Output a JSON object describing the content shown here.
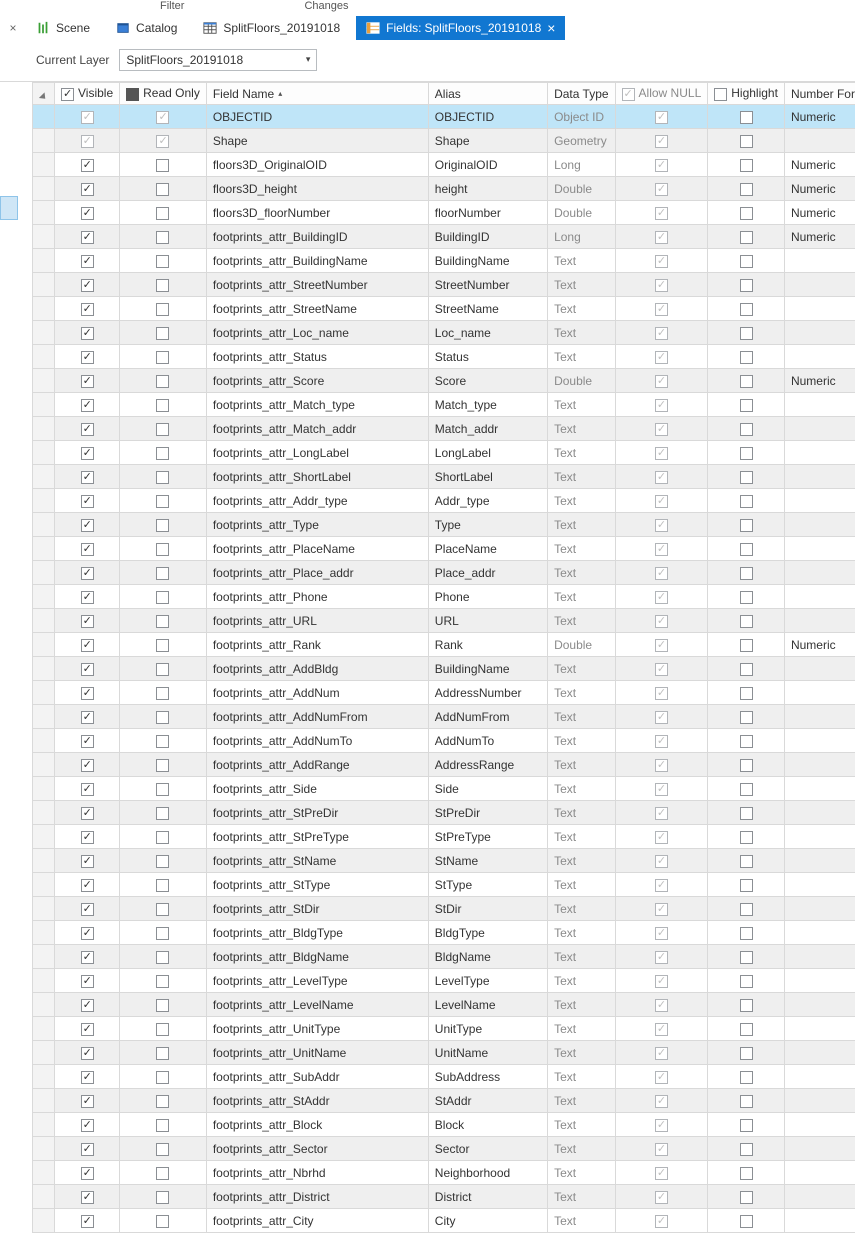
{
  "topmenu": {
    "filter": "Filter",
    "changes": "Changes"
  },
  "tabs": {
    "scene": "Scene",
    "catalog": "Catalog",
    "splitfloors": "SplitFloors_20191018",
    "fields_prefix": "Fields:",
    "fields_value": "SplitFloors_20191018"
  },
  "toolbar": {
    "currentLayerLabel": "Current Layer",
    "currentLayerValue": "SplitFloors_20191018"
  },
  "headers": {
    "visible": "Visible",
    "readonly": "Read Only",
    "fieldname": "Field Name",
    "alias": "Alias",
    "datatype": "Data Type",
    "allownull": "Allow NULL",
    "highlight": "Highlight",
    "numberformat": "Number Format"
  },
  "rows": [
    {
      "field": "OBJECTID",
      "alias": "OBJECTID",
      "type": "Object ID",
      "ro": true,
      "nullGrey": true,
      "num": "Numeric",
      "sel": true,
      "typeGrey": true
    },
    {
      "field": "Shape",
      "alias": "Shape",
      "type": "Geometry",
      "ro": true,
      "nullGrey": true,
      "num": "",
      "typeGrey": true
    },
    {
      "field": "floors3D_OriginalOID",
      "alias": "OriginalOID",
      "type": "Long",
      "ro": false,
      "nullGrey": true,
      "num": "Numeric",
      "typeGrey": true
    },
    {
      "field": "floors3D_height",
      "alias": "height",
      "type": "Double",
      "ro": false,
      "nullGrey": true,
      "num": "Numeric",
      "typeGrey": true
    },
    {
      "field": "floors3D_floorNumber",
      "alias": "floorNumber",
      "type": "Double",
      "ro": false,
      "nullGrey": true,
      "num": "Numeric",
      "typeGrey": true
    },
    {
      "field": "footprints_attr_BuildingID",
      "alias": "BuildingID",
      "type": "Long",
      "ro": false,
      "nullGrey": true,
      "num": "Numeric",
      "typeGrey": true
    },
    {
      "field": "footprints_attr_BuildingName",
      "alias": "BuildingName",
      "type": "Text",
      "ro": false,
      "nullGrey": true,
      "num": "",
      "typeGrey": true
    },
    {
      "field": "footprints_attr_StreetNumber",
      "alias": "StreetNumber",
      "type": "Text",
      "ro": false,
      "nullGrey": true,
      "num": "",
      "typeGrey": true
    },
    {
      "field": "footprints_attr_StreetName",
      "alias": "StreetName",
      "type": "Text",
      "ro": false,
      "nullGrey": true,
      "num": "",
      "typeGrey": true
    },
    {
      "field": "footprints_attr_Loc_name",
      "alias": "Loc_name",
      "type": "Text",
      "ro": false,
      "nullGrey": true,
      "num": "",
      "typeGrey": true
    },
    {
      "field": "footprints_attr_Status",
      "alias": "Status",
      "type": "Text",
      "ro": false,
      "nullGrey": true,
      "num": "",
      "typeGrey": true
    },
    {
      "field": "footprints_attr_Score",
      "alias": "Score",
      "type": "Double",
      "ro": false,
      "nullGrey": true,
      "num": "Numeric",
      "typeGrey": true
    },
    {
      "field": "footprints_attr_Match_type",
      "alias": "Match_type",
      "type": "Text",
      "ro": false,
      "nullGrey": true,
      "num": "",
      "typeGrey": true
    },
    {
      "field": "footprints_attr_Match_addr",
      "alias": "Match_addr",
      "type": "Text",
      "ro": false,
      "nullGrey": true,
      "num": "",
      "typeGrey": true
    },
    {
      "field": "footprints_attr_LongLabel",
      "alias": "LongLabel",
      "type": "Text",
      "ro": false,
      "nullGrey": true,
      "num": "",
      "typeGrey": true
    },
    {
      "field": "footprints_attr_ShortLabel",
      "alias": "ShortLabel",
      "type": "Text",
      "ro": false,
      "nullGrey": true,
      "num": "",
      "typeGrey": true
    },
    {
      "field": "footprints_attr_Addr_type",
      "alias": "Addr_type",
      "type": "Text",
      "ro": false,
      "nullGrey": true,
      "num": "",
      "typeGrey": true
    },
    {
      "field": "footprints_attr_Type",
      "alias": "Type",
      "type": "Text",
      "ro": false,
      "nullGrey": true,
      "num": "",
      "typeGrey": true
    },
    {
      "field": "footprints_attr_PlaceName",
      "alias": "PlaceName",
      "type": "Text",
      "ro": false,
      "nullGrey": true,
      "num": "",
      "typeGrey": true
    },
    {
      "field": "footprints_attr_Place_addr",
      "alias": "Place_addr",
      "type": "Text",
      "ro": false,
      "nullGrey": true,
      "num": "",
      "typeGrey": true
    },
    {
      "field": "footprints_attr_Phone",
      "alias": "Phone",
      "type": "Text",
      "ro": false,
      "nullGrey": true,
      "num": "",
      "typeGrey": true
    },
    {
      "field": "footprints_attr_URL",
      "alias": "URL",
      "type": "Text",
      "ro": false,
      "nullGrey": true,
      "num": "",
      "typeGrey": true
    },
    {
      "field": "footprints_attr_Rank",
      "alias": "Rank",
      "type": "Double",
      "ro": false,
      "nullGrey": true,
      "num": "Numeric",
      "typeGrey": true
    },
    {
      "field": "footprints_attr_AddBldg",
      "alias": "BuildingName",
      "type": "Text",
      "ro": false,
      "nullGrey": true,
      "num": "",
      "typeGrey": true
    },
    {
      "field": "footprints_attr_AddNum",
      "alias": "AddressNumber",
      "type": "Text",
      "ro": false,
      "nullGrey": true,
      "num": "",
      "typeGrey": true
    },
    {
      "field": "footprints_attr_AddNumFrom",
      "alias": "AddNumFrom",
      "type": "Text",
      "ro": false,
      "nullGrey": true,
      "num": "",
      "typeGrey": true
    },
    {
      "field": "footprints_attr_AddNumTo",
      "alias": "AddNumTo",
      "type": "Text",
      "ro": false,
      "nullGrey": true,
      "num": "",
      "typeGrey": true
    },
    {
      "field": "footprints_attr_AddRange",
      "alias": "AddressRange",
      "type": "Text",
      "ro": false,
      "nullGrey": true,
      "num": "",
      "typeGrey": true
    },
    {
      "field": "footprints_attr_Side",
      "alias": "Side",
      "type": "Text",
      "ro": false,
      "nullGrey": true,
      "num": "",
      "typeGrey": true
    },
    {
      "field": "footprints_attr_StPreDir",
      "alias": "StPreDir",
      "type": "Text",
      "ro": false,
      "nullGrey": true,
      "num": "",
      "typeGrey": true
    },
    {
      "field": "footprints_attr_StPreType",
      "alias": "StPreType",
      "type": "Text",
      "ro": false,
      "nullGrey": true,
      "num": "",
      "typeGrey": true
    },
    {
      "field": "footprints_attr_StName",
      "alias": "StName",
      "type": "Text",
      "ro": false,
      "nullGrey": true,
      "num": "",
      "typeGrey": true
    },
    {
      "field": "footprints_attr_StType",
      "alias": "StType",
      "type": "Text",
      "ro": false,
      "nullGrey": true,
      "num": "",
      "typeGrey": true
    },
    {
      "field": "footprints_attr_StDir",
      "alias": "StDir",
      "type": "Text",
      "ro": false,
      "nullGrey": true,
      "num": "",
      "typeGrey": true
    },
    {
      "field": "footprints_attr_BldgType",
      "alias": "BldgType",
      "type": "Text",
      "ro": false,
      "nullGrey": true,
      "num": "",
      "typeGrey": true
    },
    {
      "field": "footprints_attr_BldgName",
      "alias": "BldgName",
      "type": "Text",
      "ro": false,
      "nullGrey": true,
      "num": "",
      "typeGrey": true
    },
    {
      "field": "footprints_attr_LevelType",
      "alias": "LevelType",
      "type": "Text",
      "ro": false,
      "nullGrey": true,
      "num": "",
      "typeGrey": true
    },
    {
      "field": "footprints_attr_LevelName",
      "alias": "LevelName",
      "type": "Text",
      "ro": false,
      "nullGrey": true,
      "num": "",
      "typeGrey": true
    },
    {
      "field": "footprints_attr_UnitType",
      "alias": "UnitType",
      "type": "Text",
      "ro": false,
      "nullGrey": true,
      "num": "",
      "typeGrey": true
    },
    {
      "field": "footprints_attr_UnitName",
      "alias": "UnitName",
      "type": "Text",
      "ro": false,
      "nullGrey": true,
      "num": "",
      "typeGrey": true
    },
    {
      "field": "footprints_attr_SubAddr",
      "alias": "SubAddress",
      "type": "Text",
      "ro": false,
      "nullGrey": true,
      "num": "",
      "typeGrey": true
    },
    {
      "field": "footprints_attr_StAddr",
      "alias": "StAddr",
      "type": "Text",
      "ro": false,
      "nullGrey": true,
      "num": "",
      "typeGrey": true
    },
    {
      "field": "footprints_attr_Block",
      "alias": "Block",
      "type": "Text",
      "ro": false,
      "nullGrey": true,
      "num": "",
      "typeGrey": true
    },
    {
      "field": "footprints_attr_Sector",
      "alias": "Sector",
      "type": "Text",
      "ro": false,
      "nullGrey": true,
      "num": "",
      "typeGrey": true
    },
    {
      "field": "footprints_attr_Nbrhd",
      "alias": "Neighborhood",
      "type": "Text",
      "ro": false,
      "nullGrey": true,
      "num": "",
      "typeGrey": true
    },
    {
      "field": "footprints_attr_District",
      "alias": "District",
      "type": "Text",
      "ro": false,
      "nullGrey": true,
      "num": "",
      "typeGrey": true
    },
    {
      "field": "footprints_attr_City",
      "alias": "City",
      "type": "Text",
      "ro": false,
      "nullGrey": true,
      "num": "",
      "typeGrey": true
    }
  ]
}
